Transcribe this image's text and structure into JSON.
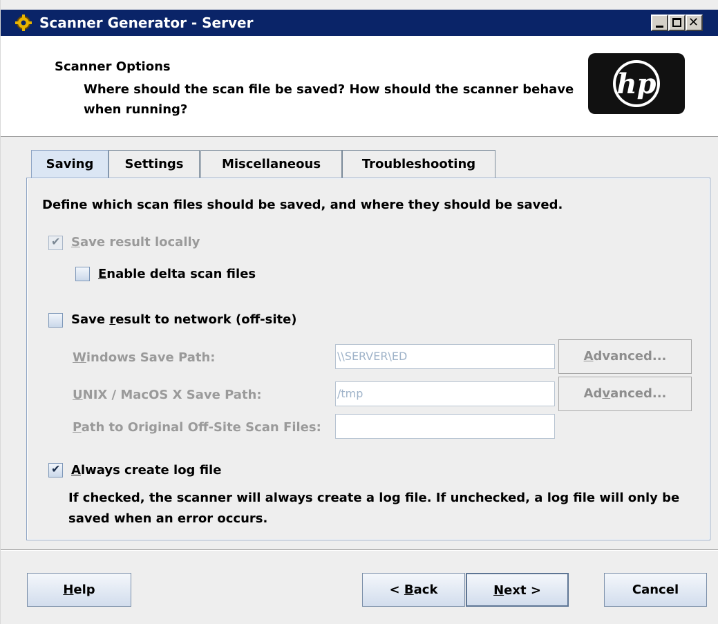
{
  "window": {
    "title": "Scanner Generator - Server",
    "close_glyph": "✕"
  },
  "header": {
    "title": "Scanner Options",
    "description": "Where should the scan file be saved?  How should the scanner behave when running?",
    "logo_text": "hp"
  },
  "tabs": [
    {
      "label": "Saving",
      "selected": true
    },
    {
      "label": "Settings",
      "selected": false
    },
    {
      "label": "Miscellaneous",
      "selected": false
    },
    {
      "label": "Troubleshooting",
      "selected": false
    }
  ],
  "saving": {
    "description": "Define which scan files should be saved, and where they should be saved.",
    "save_locally": {
      "label_mnemonic": "S",
      "label_rest": "ave result locally",
      "checked": true,
      "enabled": false
    },
    "delta_files": {
      "label_mnemonic": "E",
      "label_rest": "nable delta scan files",
      "checked": false,
      "enabled": true
    },
    "save_network": {
      "label_pre": "Save ",
      "label_mnemonic": "r",
      "label_rest": "esult to network (off-site)",
      "checked": false,
      "enabled": true
    },
    "windows_path": {
      "label_mnemonic": "W",
      "label_rest": "indows Save Path:",
      "value": "\\\\SERVER\\ED",
      "button_pre": "",
      "button_mnemonic": "A",
      "button_rest": "dvanced..."
    },
    "unix_path": {
      "label_mnemonic": "U",
      "label_rest": "NIX / MacOS X Save Path:",
      "value": "/tmp",
      "button_pre": "Ad",
      "button_mnemonic": "v",
      "button_rest": "anced..."
    },
    "original_path": {
      "label_mnemonic": "P",
      "label_rest": "ath to Original Off-Site Scan Files:",
      "value": ""
    },
    "log_file": {
      "label_mnemonic": "A",
      "label_rest": "lways create log file",
      "checked": true,
      "enabled": true
    },
    "log_note": "If checked, the scanner will always create a log file.  If unchecked, a log file will only be saved when an error occurs."
  },
  "footer": {
    "help": {
      "mnemonic": "H",
      "rest": "elp"
    },
    "back": {
      "pre": "< ",
      "mnemonic": "B",
      "rest": "ack"
    },
    "next": {
      "mnemonic": "N",
      "rest": "ext >"
    },
    "cancel": "Cancel"
  },
  "colors": {
    "titlebar": "#0a2468",
    "tab_active": "#dbe6f4",
    "disabled_text": "#9a9a9a"
  }
}
